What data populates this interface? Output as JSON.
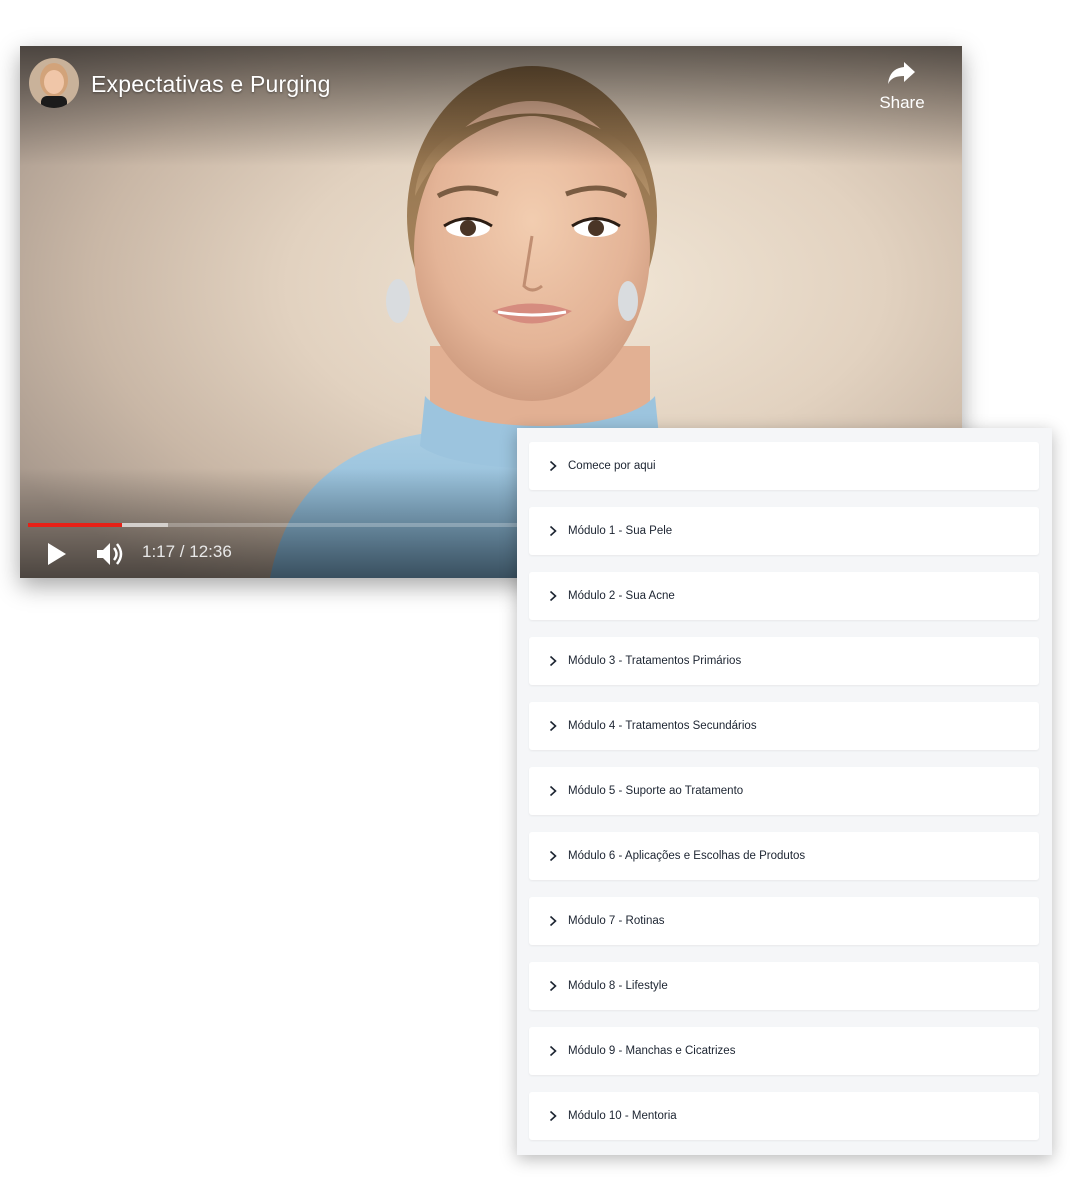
{
  "video": {
    "title": "Expectativas e Purging",
    "share_label": "Share",
    "time": "1:17 / 12:36",
    "played_fraction": 0.1016,
    "buffered_fraction": 0.1516
  },
  "modules": {
    "items": [
      {
        "label": "Comece por aqui"
      },
      {
        "label": "Módulo 1 - Sua Pele"
      },
      {
        "label": "Módulo 2 - Sua Acne"
      },
      {
        "label": "Módulo 3 - Tratamentos Primários"
      },
      {
        "label": "Módulo 4 - Tratamentos Secundários"
      },
      {
        "label": "Módulo 5 - Suporte ao Tratamento"
      },
      {
        "label": "Módulo 6 - Aplicações e Escolhas de Produtos"
      },
      {
        "label": "Módulo 7 - Rotinas"
      },
      {
        "label": "Módulo 8 - Lifestyle"
      },
      {
        "label": "Módulo 9 - Manchas e Cicatrizes"
      },
      {
        "label": "Módulo 10 - Mentoria"
      }
    ]
  },
  "colors": {
    "progress_played": "#e62117",
    "list_background": "#f5f6f8",
    "item_text": "#1c2431"
  },
  "icons": {
    "play": "play-icon",
    "volume": "volume-icon",
    "share": "share-arrow-icon",
    "expand": "chevron-right-icon"
  }
}
